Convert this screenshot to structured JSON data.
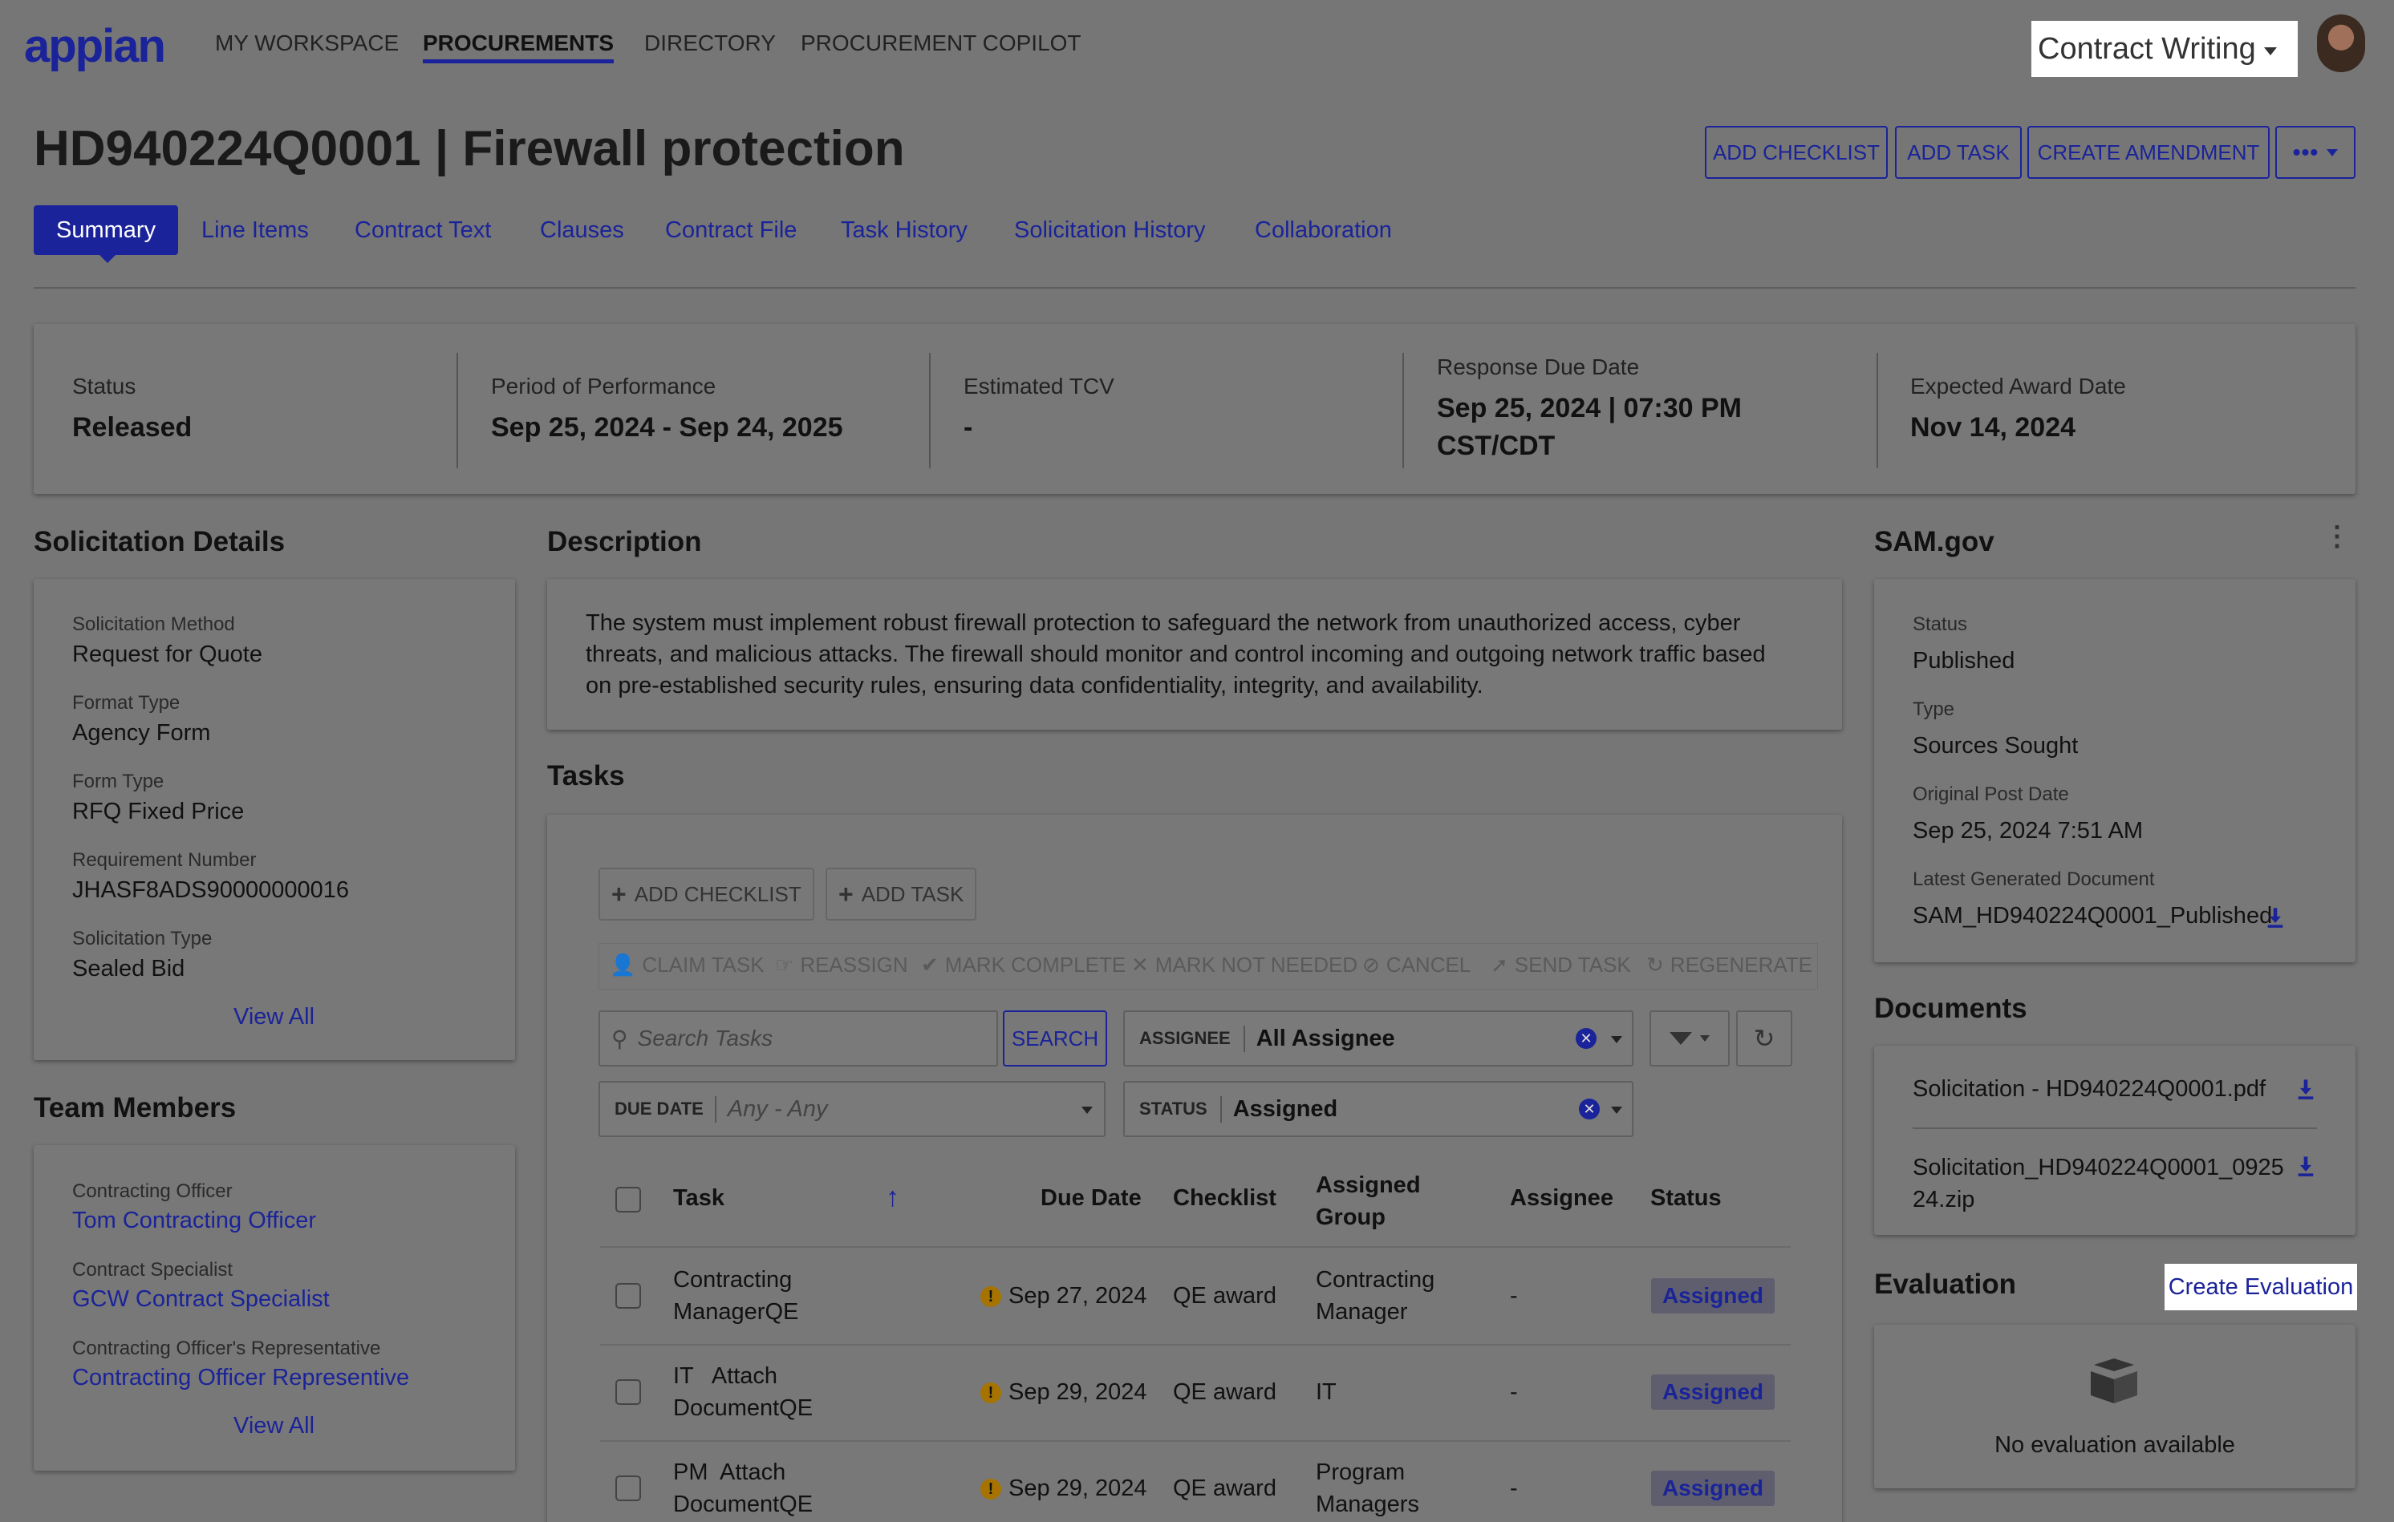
{
  "brand": {
    "logo": "appian"
  },
  "topnav": {
    "items": [
      "MY WORKSPACE",
      "PROCUREMENTS",
      "DIRECTORY",
      "PROCUREMENT COPILOT"
    ],
    "app_switcher": "Contract Writing"
  },
  "header": {
    "title": "HD940224Q0001 | Firewall protection",
    "buttons": {
      "add_checklist": "ADD CHECKLIST",
      "add_task": "ADD TASK",
      "create_amendment": "CREATE AMENDMENT"
    }
  },
  "tabs": [
    "Summary",
    "Line Items",
    "Contract Text",
    "Clauses",
    "Contract File",
    "Task History",
    "Solicitation History",
    "Collaboration"
  ],
  "summary": {
    "status": {
      "label": "Status",
      "value": "Released"
    },
    "period": {
      "label": "Period of Performance",
      "value": "Sep 25, 2024 - Sep 24, 2025"
    },
    "tcv": {
      "label": "Estimated TCV",
      "value": "-"
    },
    "response_due": {
      "label": "Response Due Date",
      "value": "Sep 25, 2024 | 07:30 PM CST/CDT"
    },
    "award": {
      "label": "Expected Award Date",
      "value": "Nov 14, 2024"
    }
  },
  "solicitation": {
    "title": "Solicitation Details",
    "fields": [
      {
        "label": "Solicitation Method",
        "value": "Request for Quote"
      },
      {
        "label": "Format Type",
        "value": "Agency Form"
      },
      {
        "label": "Form Type",
        "value": "RFQ Fixed Price"
      },
      {
        "label": "Requirement Number",
        "value": "JHASF8ADS90000000016"
      },
      {
        "label": "Solicitation Type",
        "value": "Sealed Bid"
      }
    ],
    "view_all": "View All"
  },
  "team": {
    "title": "Team Members",
    "members": [
      {
        "role": "Contracting Officer",
        "name": "Tom Contracting Officer"
      },
      {
        "role": "Contract Specialist",
        "name": "GCW Contract Specialist"
      },
      {
        "role": "Contracting Officer's Representative",
        "name": "Contracting Officer Representive"
      }
    ],
    "view_all": "View All"
  },
  "description": {
    "title": "Description",
    "lines": [
      "The system must implement robust firewall protection to safeguard the network from unauthorized access, cyber",
      "threats, and malicious attacks. The firewall should monitor and control incoming and outgoing network traffic based",
      "on pre-established security rules, ensuring data confidentiality, integrity, and availability."
    ]
  },
  "tasks": {
    "title": "Tasks",
    "add_checklist": "ADD CHECKLIST",
    "add_task": "ADD TASK",
    "actions": [
      "CLAIM TASK",
      "REASSIGN",
      "MARK COMPLETE",
      "MARK NOT NEEDED",
      "CANCEL",
      "SEND TASK",
      "REGENERATE"
    ],
    "search_placeholder": "Search Tasks",
    "search_button": "SEARCH",
    "assignee_label": "ASSIGNEE",
    "assignee_value": "All Assignee",
    "due_label": "DUE DATE",
    "due_value": "Any - Any",
    "status_label": "STATUS",
    "status_value": "Assigned",
    "columns": {
      "task": "Task",
      "due": "Due Date",
      "checklist": "Checklist",
      "group_1": "Assigned",
      "group_2": "Group",
      "assignee": "Assignee",
      "status": "Status"
    },
    "rows": [
      {
        "task_1": "Contracting",
        "task_2": "ManagerQE",
        "due": "Sep 27, 2024",
        "checklist": "QE award",
        "group_1": "Contracting",
        "group_2": "Manager",
        "assignee": "-",
        "status": "Assigned"
      },
      {
        "task_1": "IT   Attach",
        "task_2": "DocumentQE",
        "due": "Sep 29, 2024",
        "checklist": "QE award",
        "group_1": "IT",
        "group_2": "",
        "assignee": "-",
        "status": "Assigned"
      },
      {
        "task_1": "PM  Attach",
        "task_2": "DocumentQE",
        "due": "Sep 29, 2024",
        "checklist": "QE award",
        "group_1": "Program",
        "group_2": "Managers",
        "assignee": "-",
        "status": "Assigned"
      }
    ]
  },
  "sam": {
    "title": "SAM.gov",
    "fields": [
      {
        "label": "Status",
        "value": "Published"
      },
      {
        "label": "Type",
        "value": "Sources Sought"
      },
      {
        "label": "Original Post Date",
        "value": "Sep 25, 2024 7:51 AM"
      },
      {
        "label": "Latest Generated Document",
        "value": "SAM_HD940224Q0001_Published"
      }
    ]
  },
  "documents": {
    "title": "Documents",
    "files": [
      {
        "line1": "Solicitation - HD940224Q0001.pdf",
        "line2": ""
      },
      {
        "line1": "Solicitation_HD940224Q0001_0925",
        "line2": "24.zip"
      }
    ]
  },
  "evaluation": {
    "title": "Evaluation",
    "create": "Create Evaluation",
    "empty": "No evaluation available"
  }
}
